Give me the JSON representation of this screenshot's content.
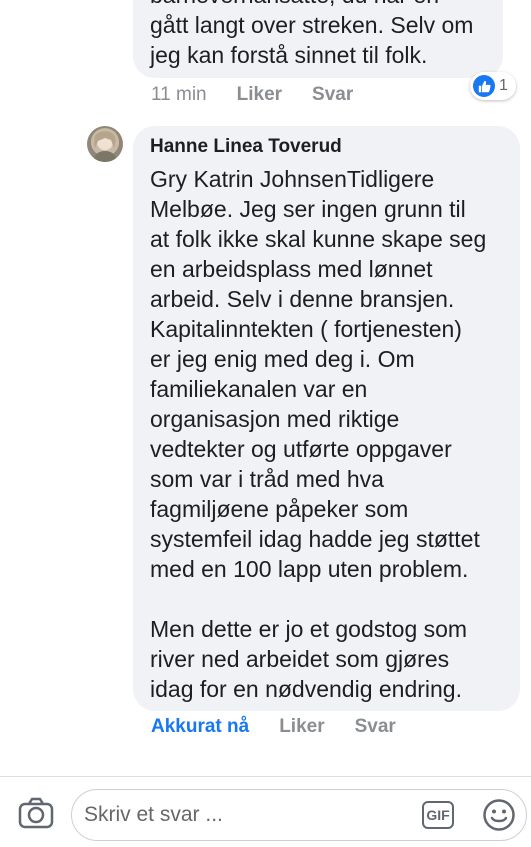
{
  "previous_comment": {
    "text": "barnevernansatte, du har en\ngått langt over streken. Selv om\njeg kan forstå sinnet til folk.",
    "time": "11 min",
    "like_label": "Liker",
    "reply_label": "Svar",
    "reaction_count": "1"
  },
  "comment": {
    "author": "Hanne Linea Toverud",
    "text": "Gry Katrin JohnsenTidligere\nMelbøe.  Jeg ser ingen grunn til\nat folk ikke skal kunne skape seg\nen arbeidsplass med lønnet\narbeid. Selv i denne bransjen.\nKapitalinntekten ( fortjenesten)\ner jeg enig med deg i.  Om\nfamiliekanalen var en\norganisasjon med riktige\nvedtekter og utførte oppgaver\nsom var i tråd med hva\nfagmiljøene påpeker som\nsystemfeil idag hadde jeg støttet\nmed en 100 lapp uten problem.\n\nMen dette er jo et godstog som\nriver ned arbeidet som gjøres\nidag for en nødvendig endring.",
    "time": "Akkurat nå",
    "like_label": "Liker",
    "reply_label": "Svar"
  },
  "composer": {
    "placeholder": "Skriv et svar ...",
    "gif_label": "GIF"
  },
  "icons": {
    "camera": "camera-icon",
    "like": "thumbs-up-icon",
    "emoji": "smiley-icon"
  },
  "colors": {
    "accent": "#1877f2",
    "bubble": "#f0f2f5",
    "meta": "#8a8d91"
  }
}
